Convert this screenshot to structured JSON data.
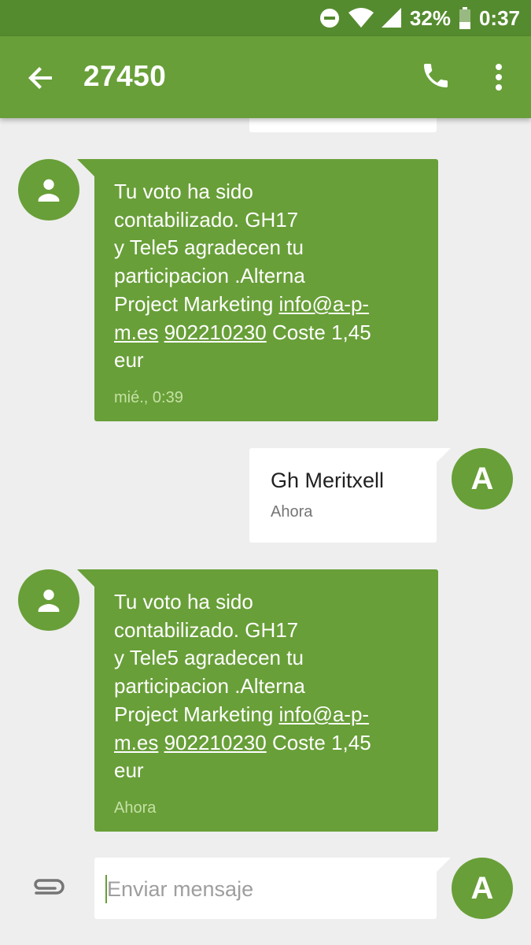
{
  "status_bar": {
    "battery_percent": "32%",
    "time": "0:37"
  },
  "toolbar": {
    "title": "27450"
  },
  "messages": [
    {
      "direction": "incoming",
      "text_lines": [
        "Tu voto ha sido",
        "contabilizado. GH17",
        "y Tele5 agradecen tu",
        "participacion .Alterna"
      ],
      "line5_pre": "Project Marketing ",
      "email_part1": "info@a-p-",
      "email_part2": "m.es",
      "phone": "902210230",
      "line6_post": " Coste 1,45",
      "line7": "eur",
      "time": "mié., 0:39"
    },
    {
      "direction": "outgoing",
      "text": "Gh Meritxell",
      "time": "Ahora",
      "avatar_letter": "A"
    },
    {
      "direction": "incoming",
      "text_lines": [
        "Tu voto ha sido",
        "contabilizado. GH17",
        "y Tele5 agradecen tu",
        "participacion .Alterna"
      ],
      "line5_pre": "Project Marketing ",
      "email_part1": "info@a-p-",
      "email_part2": "m.es",
      "phone": "902210230",
      "line6_post": " Coste 1,45",
      "line7": "eur",
      "time": "Ahora"
    }
  ],
  "compose": {
    "placeholder": "Enviar mensaje",
    "avatar_letter": "A"
  },
  "icons": [
    "dnd-icon",
    "wifi-icon",
    "signal-icon",
    "battery-icon",
    "back-arrow-icon",
    "phone-icon",
    "more-vert-icon",
    "person-icon",
    "paperclip-icon"
  ],
  "colors": {
    "status_bar": "#558b2f",
    "toolbar": "#689f38",
    "incoming_bubble": "#689f38",
    "outgoing_bubble": "#ffffff",
    "background": "#eeeeee"
  }
}
